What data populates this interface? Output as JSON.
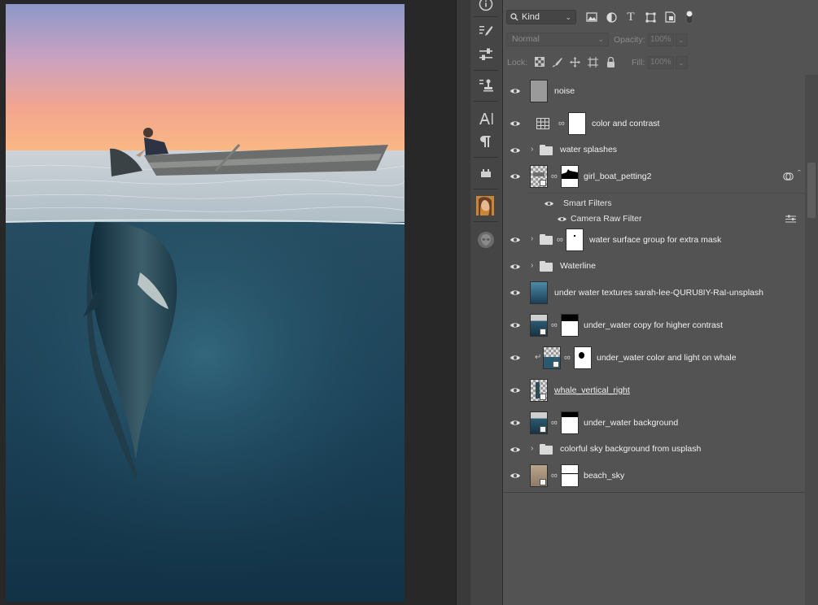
{
  "toolbar": {
    "kind_label": "Kind",
    "blend_mode": "Normal",
    "opacity_label": "Opacity:",
    "opacity_value": "100%",
    "lock_label": "Lock:",
    "fill_label": "Fill:",
    "fill_value": "100%"
  },
  "layers": [
    {
      "name": "noise"
    },
    {
      "name": "color and contrast"
    },
    {
      "name": "water splashes"
    },
    {
      "name": "girl_boat_petting2"
    },
    {
      "name": "Smart Filters"
    },
    {
      "name": "Camera Raw Filter"
    },
    {
      "name": "water surface group for extra mask"
    },
    {
      "name": "Waterline"
    },
    {
      "name": "under water textures sarah-lee-QURU8IY-RaI-unsplash"
    },
    {
      "name": "under_water copy for higher contrast"
    },
    {
      "name": "under_water color and light on whale"
    },
    {
      "name": "whale_vertical_right"
    },
    {
      "name": "under_water background"
    },
    {
      "name": "colorful sky background from usplash"
    },
    {
      "name": "beach_sky"
    }
  ]
}
